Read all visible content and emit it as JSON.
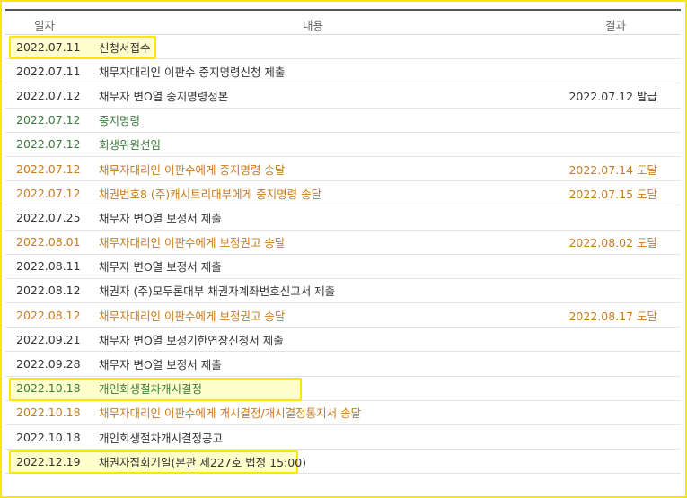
{
  "headers": {
    "date": "일자",
    "content": "내용",
    "result": "결과"
  },
  "rows": [
    {
      "date": "2022.07.11",
      "content": "신청서접수",
      "result": "",
      "color": "black",
      "highlight": "both"
    },
    {
      "date": "2022.07.11",
      "content": "채무자대리인 이판수 중지명령신청 제출",
      "result": "",
      "color": "black"
    },
    {
      "date": "2022.07.12",
      "content": "채무자 변O열 중지명령정본",
      "result": "2022.07.12 발급",
      "color": "black"
    },
    {
      "date": "2022.07.12",
      "content": "중지명령",
      "result": "",
      "color": "green"
    },
    {
      "date": "2022.07.12",
      "content": "회생위원선임",
      "result": "",
      "color": "green"
    },
    {
      "date": "2022.07.12",
      "content": "채무자대리인 이판수에게 중지명령 송달",
      "result": "2022.07.14 도달",
      "color": "orange"
    },
    {
      "date": "2022.07.12",
      "content": "채권번호8 (주)캐시트리대부에게 중지명령 송달",
      "result": "2022.07.15 도달",
      "color": "orange"
    },
    {
      "date": "2022.07.25",
      "content": "채무자 변O열 보정서 제출",
      "result": "",
      "color": "black"
    },
    {
      "date": "2022.08.01",
      "content": "채무자대리인 이판수에게 보정권고 송달",
      "result": "2022.08.02 도달",
      "color": "orange"
    },
    {
      "date": "2022.08.11",
      "content": "채무자 변O열 보정서 제출",
      "result": "",
      "color": "black"
    },
    {
      "date": "2022.08.12",
      "content": "채권자 (주)모두론대부 채권자계좌번호신고서 제출",
      "result": "",
      "color": "black"
    },
    {
      "date": "2022.08.12",
      "content": "채무자대리인 이판수에게 보정권고 송달",
      "result": "2022.08.17 도달",
      "color": "orange"
    },
    {
      "date": "2022.09.21",
      "content": "채무자 변O열 보정기한연장신청서 제출",
      "result": "",
      "color": "black"
    },
    {
      "date": "2022.09.28",
      "content": "채무자 변O열 보정서 제출",
      "result": "",
      "color": "black"
    },
    {
      "date": "2022.10.18",
      "content": "개인회생절차개시결정",
      "result": "",
      "color": "green",
      "highlight": "both"
    },
    {
      "date": "2022.10.18",
      "content": "채무자대리인 이판수에게 개시결정/개시결정통지서 송달",
      "result": "",
      "color": "orange"
    },
    {
      "date": "2022.10.18",
      "content": "개인회생절차개시결정공고",
      "result": "",
      "color": "black"
    },
    {
      "date": "2022.12.19",
      "content": "채권자집회기일(본관 제227호 법정 15:00)",
      "result": "",
      "color": "black",
      "highlight": "both"
    }
  ]
}
